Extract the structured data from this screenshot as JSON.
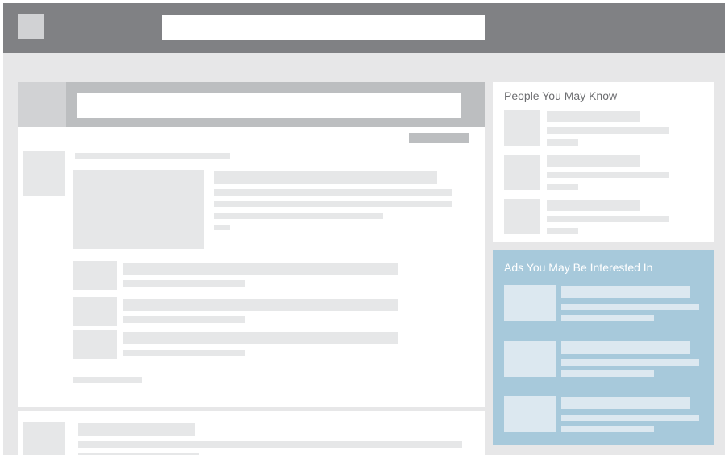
{
  "right_rail": {
    "people_title": "People You May Know",
    "ads_title": "Ads You May Be Interested In"
  }
}
